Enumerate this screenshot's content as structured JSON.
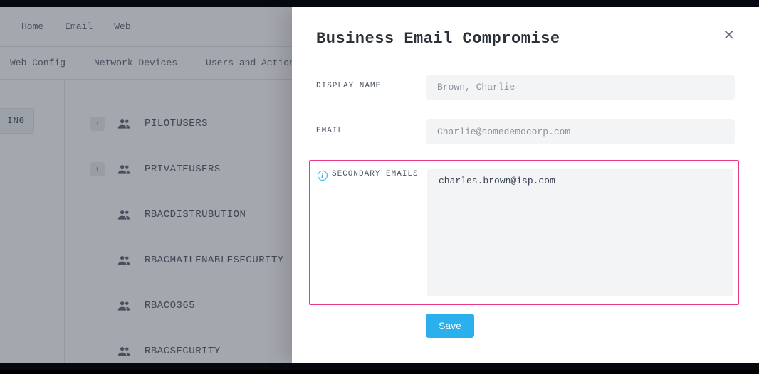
{
  "nav": {
    "top": [
      "Home",
      "Email",
      "Web"
    ],
    "sub": [
      "Web Config",
      "Network Devices",
      "Users and Actions"
    ]
  },
  "left_chip": "ING",
  "groups": [
    {
      "label": "PILOTUSERS",
      "expandable": true
    },
    {
      "label": "PRIVATEUSERS",
      "expandable": true
    },
    {
      "label": "RBACDISTRUBUTION",
      "expandable": false
    },
    {
      "label": "RBACMAILENABLESECURITY",
      "expandable": false
    },
    {
      "label": "RBACO365",
      "expandable": false
    },
    {
      "label": "RBACSECURITY",
      "expandable": false
    }
  ],
  "modal": {
    "title": "Business Email Compromise",
    "labels": {
      "display_name": "DISPLAY NAME",
      "email": "EMAIL",
      "secondary_emails": "SECONDARY EMAILS"
    },
    "placeholders": {
      "display_name": "Brown, Charlie",
      "email": "Charlie@somedemocorp.com"
    },
    "values": {
      "secondary_emails": "charles.brown@isp.com"
    },
    "save_label": "Save"
  }
}
